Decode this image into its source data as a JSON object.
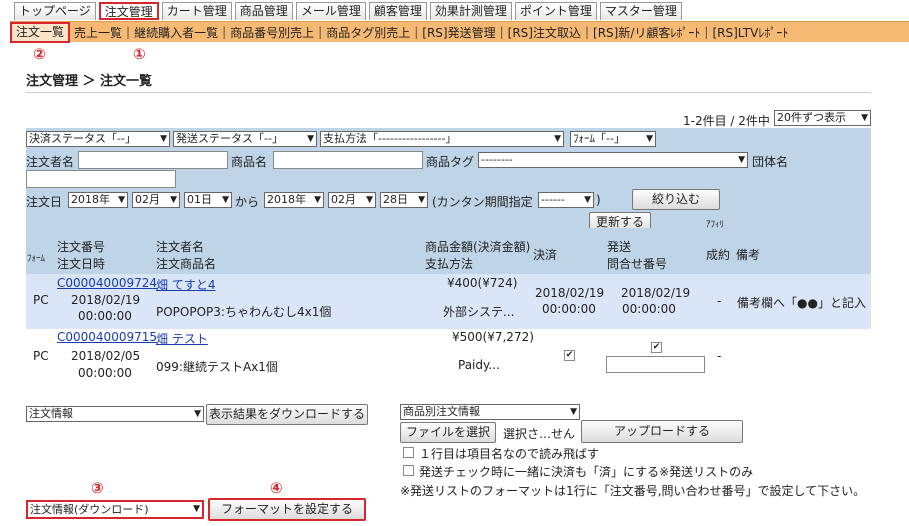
{
  "nav": {
    "tabs": [
      "トップページ",
      "注文管理",
      "カート管理",
      "商品管理",
      "メール管理",
      "顧客管理",
      "効果計測管理",
      "ポイント管理",
      "マスター管理"
    ],
    "active_index": 1
  },
  "subnav": {
    "items": [
      "注文一覧",
      "売上一覧",
      "継続購入者一覧",
      "商品番号別売上",
      "商品タグ別売上",
      "[RS]発送管理",
      "[RS]注文取込",
      "[RS]新/リ顧客ﾚﾎﾟｰﾄ",
      "[RS]LTVﾚﾎﾟｰﾄ"
    ]
  },
  "markers": {
    "m1": "①",
    "m2": "②",
    "m3": "③",
    "m4": "④"
  },
  "breadcrumb": "注文管理 ＞ 注文一覧",
  "results": {
    "count_text": "1-2件目 / 2件中",
    "per_page": "20件ずつ表示"
  },
  "filters": {
    "payment_status": "決済ステータス「--」",
    "shipping_status": "発送ステータス「--」",
    "payment_method": "支払方法「-----------------」",
    "form": "ﾌｫｰﾑ「--」",
    "orderer_label": "注文者名",
    "product_label": "商品名",
    "tag_label": "商品タグ",
    "tag_value": "--------",
    "group_label": "団体名",
    "date_label": "注文日",
    "from_year": "2018年",
    "from_month": "02月",
    "from_day": "01日",
    "kara": "から",
    "to_year": "2018年",
    "to_month": "02月",
    "to_day": "28日",
    "easy_label": "(カンタン期間指定",
    "easy_value": "------",
    "easy_close": ")",
    "narrow_button": "絞り込む",
    "update_button": "更新する"
  },
  "table": {
    "headers": {
      "form": "ﾌｫｰﾑ",
      "order_no": "注文番号",
      "order_date": "注文日時",
      "orderer": "注文者名",
      "product": "注文商品名",
      "amount": "商品金額(決済金額)",
      "payment_method": "支払方法",
      "settle": "決済",
      "ship": "発送",
      "inquiry": "問合せ番号",
      "affiliate": "ｱﾌｨﾘ",
      "success": "成約",
      "remarks": "備考"
    },
    "rows": [
      {
        "form": "PC",
        "order_no": "C000040009724",
        "date": "2018/02/19",
        "time": "00:00:00",
        "orderer": "畑 てすと4",
        "product": "POPOPOP3:ちゃわんむし4x1個",
        "amount": "¥400(¥724)",
        "payment": "外部システ...",
        "settle_date": "2018/02/19",
        "settle_time": "00:00:00",
        "ship_date": "2018/02/19",
        "ship_time": "00:00:00",
        "success": "-",
        "remarks": "備考欄へ「●●」と記入"
      },
      {
        "form": "PC",
        "order_no": "C000040009715",
        "date": "2018/02/05",
        "time": "00:00:00",
        "orderer": "畑 テスト",
        "product": "099:継続テストAx1個",
        "amount": "¥500(¥7,272)",
        "payment": "Paidy...",
        "settle_check": "✔",
        "ship_check": "✔",
        "success": "-"
      }
    ]
  },
  "bottom": {
    "order_info_select": "注文情報",
    "download_results_button": "表示結果をダウンロードする",
    "product_order_select": "商品別注文情報",
    "choose_file_button": "ファイルを選択",
    "no_file_text": "選択さ…せん",
    "upload_button": "アップロードする",
    "skip_first_row": "１行目は項目名なので読み飛ばす",
    "ship_check_settle": "発送チェック時に一緒に決済も「済」にする※発送リストのみ",
    "format_note": "※発送リストのフォーマットは1行に「注文番号,問い合わせ番号」で設定して下さい。",
    "download_format_select": "注文情報(ダウンロード)",
    "set_format_button": "フォーマットを設定する"
  },
  "colors": {
    "panel": "#bfd4e6",
    "subnav": "#f6b973",
    "highlight": "#d9262c",
    "row": "#dae6f7"
  }
}
